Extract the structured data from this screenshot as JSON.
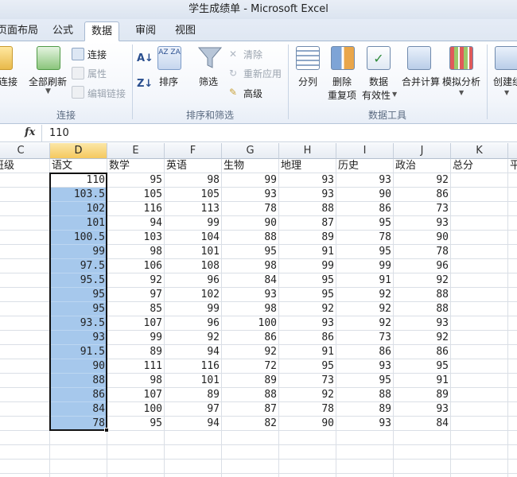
{
  "window": {
    "title": "学生成绩单 - Microsoft Excel"
  },
  "tabs": [
    {
      "label": "页面布局"
    },
    {
      "label": "公式"
    },
    {
      "label": "数据",
      "active": true
    },
    {
      "label": "审阅"
    },
    {
      "label": "视图"
    }
  ],
  "ribbon": {
    "groups": {
      "connections": {
        "label": "连接",
        "existing": "连接",
        "refresh_all": "全部刷新",
        "connections": "连接",
        "properties": "属性",
        "edit_links": "编辑链接"
      },
      "sort_filter": {
        "label": "排序和筛选",
        "sort": "排序",
        "filter": "筛选",
        "clear": "清除",
        "reapply": "重新应用",
        "advanced": "高级"
      },
      "data_tools": {
        "label": "数据工具",
        "text_to_columns": "分列",
        "remove_duplicates_1": "删除",
        "remove_duplicates_2": "重复项",
        "validation_1": "数据",
        "validation_2": "有效性",
        "consolidate": "合并计算",
        "what_if": "模拟分析"
      },
      "outline": {
        "create_group": "创建组"
      }
    }
  },
  "formula_bar": {
    "fx": "fx",
    "value": "110"
  },
  "sheet": {
    "columns": [
      "C",
      "D",
      "E",
      "F",
      "G",
      "H",
      "I",
      "J",
      "K"
    ],
    "headers": [
      "班级",
      "语文",
      "数学",
      "英语",
      "生物",
      "地理",
      "历史",
      "政治",
      "总分",
      "平"
    ],
    "rows": [
      [
        "110",
        "95",
        "98",
        "99",
        "93",
        "93",
        "92"
      ],
      [
        "103.5",
        "105",
        "105",
        "93",
        "93",
        "90",
        "86"
      ],
      [
        "102",
        "116",
        "113",
        "78",
        "88",
        "86",
        "73"
      ],
      [
        "101",
        "94",
        "99",
        "90",
        "87",
        "95",
        "93"
      ],
      [
        "100.5",
        "103",
        "104",
        "88",
        "89",
        "78",
        "90"
      ],
      [
        "99",
        "98",
        "101",
        "95",
        "91",
        "95",
        "78"
      ],
      [
        "97.5",
        "106",
        "108",
        "98",
        "99",
        "99",
        "96"
      ],
      [
        "95.5",
        "92",
        "96",
        "84",
        "95",
        "91",
        "92"
      ],
      [
        "95",
        "97",
        "102",
        "93",
        "95",
        "92",
        "88"
      ],
      [
        "95",
        "85",
        "99",
        "98",
        "92",
        "92",
        "88"
      ],
      [
        "93.5",
        "107",
        "96",
        "100",
        "93",
        "92",
        "93"
      ],
      [
        "93",
        "99",
        "92",
        "86",
        "86",
        "73",
        "92"
      ],
      [
        "91.5",
        "89",
        "94",
        "92",
        "91",
        "86",
        "86"
      ],
      [
        "90",
        "111",
        "116",
        "72",
        "95",
        "93",
        "95"
      ],
      [
        "88",
        "98",
        "101",
        "89",
        "73",
        "95",
        "91"
      ],
      [
        "86",
        "107",
        "89",
        "88",
        "92",
        "88",
        "89"
      ],
      [
        "84",
        "100",
        "97",
        "87",
        "78",
        "89",
        "93"
      ],
      [
        "78",
        "95",
        "94",
        "82",
        "90",
        "93",
        "84"
      ]
    ]
  },
  "colors": {
    "selection": "#a6c8ec",
    "selected_header": "#f5c95e",
    "grid_line": "#dadfe6"
  }
}
